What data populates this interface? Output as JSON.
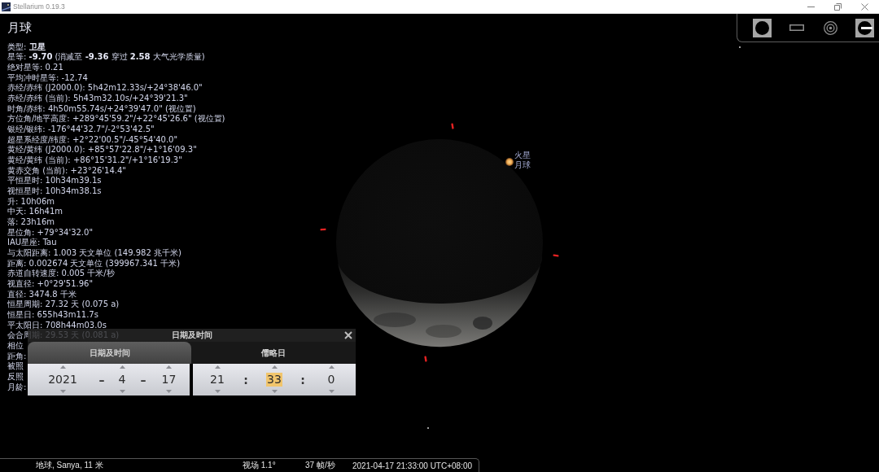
{
  "window": {
    "title": "Stellarium 0.19.3"
  },
  "view_toolbar": {
    "buttons": [
      {
        "on": true
      },
      {
        "on": false
      },
      {
        "on": false
      },
      {
        "on": true
      }
    ]
  },
  "object_info": {
    "title": "月球",
    "lines": [
      "类型: **卫星**",
      "星等: **-9.70** (消减至 **-9.36** 穿过 **2.58** 大气光学质量)",
      "绝对星等: 0.21",
      "平均冲时星等: -12.74",
      "赤经/赤纬 (J2000.0): 5h42m12.33s/+24°38'46.0\"",
      "赤经/赤纬 (当前): 5h43m32.10s/+24°39'21.3\"",
      "时角/赤纬: 4h50m55.74s/+24°39'47.0\" (视位置)",
      "方位角/地平高度: +289°45'59.2\"/+22°45'26.6\" (视位置)",
      "银经/银纬: -176°44'32.7\"/-2°53'42.5\"",
      "超星系经度/纬度: +2°22'00.5\"/-45°54'40.0\"",
      "黄经/黄纬 (J2000.0): +85°57'22.8\"/+1°16'09.3\"",
      "黄经/黄纬 (当前): +86°15'31.2\"/+1°16'19.3\"",
      "黄赤交角 (当前): +23°26'14.4\"",
      "平恒星时: 10h34m39.1s",
      "视恒星时: 10h34m38.1s",
      "升: 10h06m",
      "中天: 16h41m",
      "落: 23h16m",
      "星位角: +79°34'32.0\"",
      "IAU星座: Tau",
      "与太阳距离: 1.003 天文单位 (149.982 兆千米)",
      "距离: 0.002674 天文单位 (399967.341 千米)",
      "赤道自转速度: 0.005 千米/秒",
      "视直径: +0°29'51.96\"",
      "直径: 3474.8 千米",
      "恒星周期: 27.32 天 (0.075 a)",
      "恒星日: 655h43m11.7s",
      "平太阳日: 708h44m03.0s",
      "会合周期: 29.53 天 (0.081 a)",
      "相位",
      "距角:",
      "被照",
      "反照",
      "月龄:"
    ]
  },
  "sky": {
    "labels": [
      "火星",
      "月球"
    ]
  },
  "date_time_dialog": {
    "title": "日期及时间",
    "tabs": [
      {
        "label": "日期及时间",
        "selected": true
      },
      {
        "label": "儒略日",
        "selected": false
      }
    ],
    "date_fields": [
      {
        "kind": "spin",
        "value": "2021",
        "selected": false
      },
      {
        "kind": "separator",
        "text": "–"
      },
      {
        "kind": "spin",
        "value": "4",
        "selected": false
      },
      {
        "kind": "separator",
        "text": "–"
      },
      {
        "kind": "spin",
        "value": "17",
        "selected": false
      }
    ],
    "time_fields": [
      {
        "kind": "spin",
        "value": "21",
        "selected": false
      },
      {
        "kind": "separator",
        "text": ":"
      },
      {
        "kind": "spin",
        "value": "33",
        "selected": true
      },
      {
        "kind": "separator",
        "text": ":"
      },
      {
        "kind": "spin",
        "value": "0",
        "selected": false
      }
    ]
  },
  "status_bar": {
    "location": "地球, Sanya, 11 米",
    "fov": "视场 1.1°",
    "fps": "37 帧/秒",
    "datetime": "2021-04-17 21:33:00 UTC+08:00"
  }
}
